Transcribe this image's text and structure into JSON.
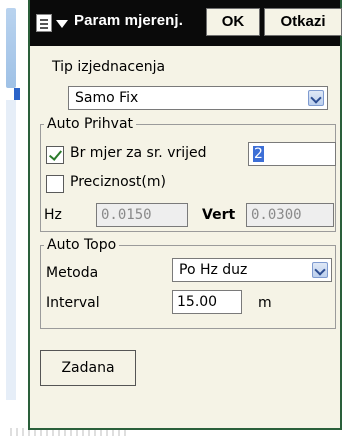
{
  "header": {
    "title": "Param mjerenj.",
    "ok_label": "OK",
    "cancel_label": "Otkazi"
  },
  "tip": {
    "label": "Tip izjednacenja",
    "value": "Samo Fix"
  },
  "auto_prihvat": {
    "title": "Auto Prihvat",
    "br_mjer_label": "Br mjer za sr. vrijed",
    "br_mjer_checked": true,
    "br_mjer_value": "2",
    "preciznost_label": "Preciznost(m)",
    "preciznost_checked": false,
    "hz_label": "Hz",
    "hz_value": "0.0150",
    "vert_label": "Vert",
    "vert_value": "0.0300"
  },
  "auto_topo": {
    "title": "Auto Topo",
    "metoda_label": "Metoda",
    "metoda_value": "Po Hz duz",
    "interval_label": "Interval",
    "interval_value": "15.00",
    "interval_unit": "m"
  },
  "zadana_label": "Zadana",
  "colors": {
    "dialog_bg": "#f5f3e6",
    "toolbar_bg": "#0a0a0a",
    "frame_border": "#2a5f3a",
    "selection": "#3d6fd6"
  }
}
